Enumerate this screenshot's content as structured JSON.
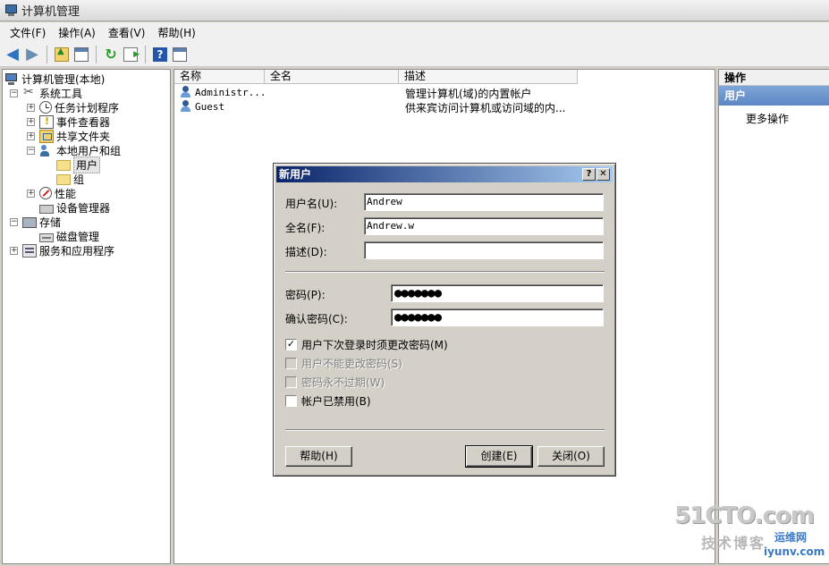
{
  "window": {
    "title": "计算机管理"
  },
  "menu": [
    "文件(F)",
    "操作(A)",
    "查看(V)",
    "帮助(H)"
  ],
  "tree": {
    "root": "计算机管理(本地)",
    "system_tools": "系统工具",
    "task_scheduler": "任务计划程序",
    "event_viewer": "事件查看器",
    "shared_folders": "共享文件夹",
    "local_users_groups": "本地用户和组",
    "users": "用户",
    "groups": "组",
    "performance": "性能",
    "device_manager": "设备管理器",
    "storage": "存储",
    "disk_management": "磁盘管理",
    "services_apps": "服务和应用程序"
  },
  "list": {
    "columns": [
      "名称",
      "全名",
      "描述"
    ],
    "rows": [
      {
        "name": "Administr...",
        "fullname": "",
        "desc": "管理计算机(域)的内置帐户"
      },
      {
        "name": "Guest",
        "fullname": "",
        "desc": "供来宾访问计算机或访问域的内..."
      }
    ]
  },
  "actions": {
    "header": "操作",
    "section": "用户",
    "more": "更多操作"
  },
  "dialog": {
    "title": "新用户",
    "help_btn": "?",
    "close_btn": "✕",
    "username_label": "用户名(U):",
    "username_value": "Andrew",
    "fullname_label": "全名(F):",
    "fullname_value": "Andrew.w",
    "description_label": "描述(D):",
    "description_value": "",
    "password_label": "密码(P):",
    "password_value": "●●●●●●●",
    "confirm_label": "确认密码(C):",
    "confirm_value": "●●●●●●●",
    "checkbox_must_change": "用户下次登录时须更改密码(M)",
    "checkbox_cannot_change": "用户不能更改密码(S)",
    "checkbox_never_expires": "密码永不过期(W)",
    "checkbox_disabled": "帐户已禁用(B)",
    "checked_mark": "✓",
    "help_button": "帮助(H)",
    "create_button": "创建(E)",
    "close_button": "关闭(O)"
  },
  "watermark": {
    "site": "51CTO.com",
    "blog": "技术博客",
    "brand": "运维网",
    "url": "iyunv.com"
  }
}
